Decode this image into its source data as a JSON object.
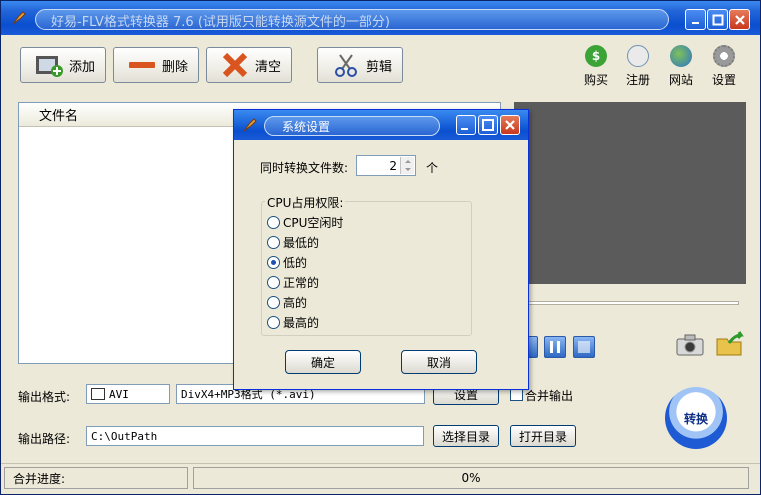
{
  "window": {
    "title": "好易-FLV格式转换器 7.6 (试用版只能转换源文件的一部分)"
  },
  "toolbar": {
    "add": "添加",
    "delete": "删除",
    "clear": "清空",
    "cut": "剪辑"
  },
  "right_tools": {
    "buy": "购买",
    "register": "注册",
    "website": "网站",
    "settings": "设置"
  },
  "filelist": {
    "col_filename": "文件名"
  },
  "output": {
    "format_label": "输出格式:",
    "format_value": "AVI",
    "format_desc": "DivX4+MP3格式 (*.avi)",
    "settings_button": "设置",
    "merge_label": "合并输出",
    "path_label": "输出路径:",
    "path_value": "C:\\OutPath",
    "choose_dir": "选择目录",
    "open_dir": "打开目录"
  },
  "convert_button": "转换",
  "status": {
    "merge_progress": "合并进度:",
    "percent": "0%"
  },
  "dialog": {
    "title": "系统设置",
    "concurrent_label": "同时转换文件数:",
    "concurrent_value": "2",
    "unit": "个",
    "cpu_group": "CPU占用权限:",
    "cpu_options": [
      "CPU空闲时",
      "最低的",
      "低的",
      "正常的",
      "高的",
      "最高的"
    ],
    "cpu_selected": "低的",
    "ok": "确定",
    "cancel": "取消"
  },
  "colors": {
    "titlebar": "#0a4fcf",
    "preview": "#5b5b5b",
    "face": "#ece9d8"
  }
}
